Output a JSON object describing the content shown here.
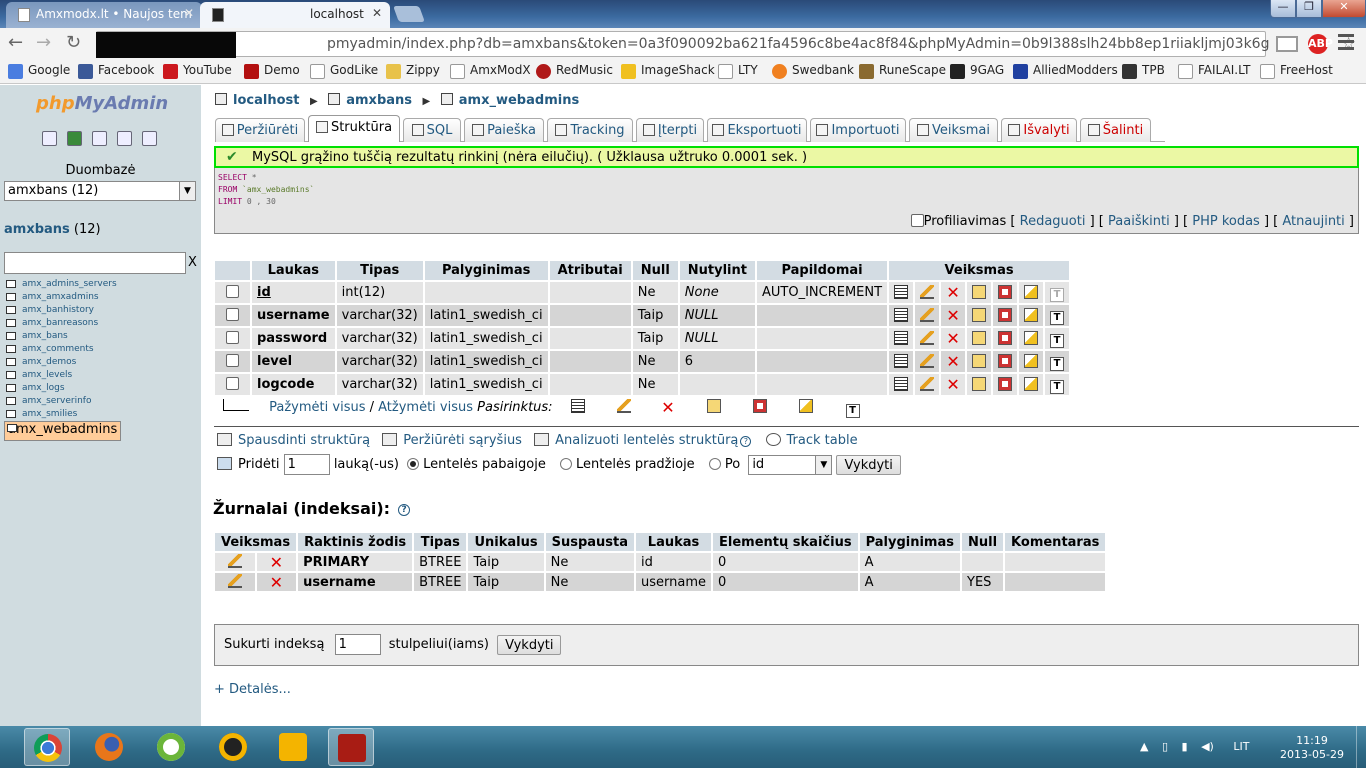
{
  "browser": {
    "tabs": [
      {
        "title": "Amxmodx.lt • Naujos tem"
      },
      {
        "title": "localhost"
      }
    ],
    "url": "pmyadmin/index.php?db=amxbans&token=0a3f090092ba621fa4596c8be4ac8f84&phpMyAdmin=0b9l388slh24bb8ep1riiakljmj03k6g",
    "bookmarks": [
      "Google",
      "Facebook",
      "YouTube",
      "Demo",
      "GodLike",
      "Zippy",
      "AmxModX",
      "RedMusic",
      "ImageShack",
      "LTY",
      "Swedbank",
      "RuneScape",
      "9GAG",
      "AlliedModders",
      "TPB",
      "FAILAI.LT",
      "FreeHost"
    ]
  },
  "sidebar": {
    "logo_a": "php",
    "logo_b": "MyAdmin",
    "db_label": "Duombazė",
    "db_select": "amxbans (12)",
    "db_name": "amxbans",
    "db_count": " (12)",
    "filter_clear": "X",
    "tables": [
      "amx_admins_servers",
      "amx_amxadmins",
      "amx_banhistory",
      "amx_banreasons",
      "amx_bans",
      "amx_comments",
      "amx_demos",
      "amx_levels",
      "amx_logs",
      "amx_serverinfo",
      "amx_smilies",
      "amx_webadmins"
    ]
  },
  "breadcrumb": {
    "server": "localhost",
    "db": "amxbans",
    "table": "amx_webadmins"
  },
  "tabs": [
    "Peržiūrėti",
    "Struktūra",
    "SQL",
    "Paieška",
    "Tracking",
    "Įterpti",
    "Eksportuoti",
    "Importuoti",
    "Veiksmai",
    "Išvalyti",
    "Šalinti"
  ],
  "message": "MySQL grąžino tuščią rezultatų rinkinį (nėra eilučių). ( Užklausa užtruko 0.0001 sek. )",
  "sql": {
    "l1_kw": "SELECT",
    "l1_rest": " *",
    "l2_kw": "FROM",
    "l2_tbl": " `amx_webadmins`",
    "l3_kw": "LIMIT",
    "l3_rest": " 0 , 30"
  },
  "sql_actions": {
    "profiling": "Profiliavimas",
    "edit": "Redaguoti",
    "explain": "Paaiškinti",
    "php": "PHP kodas",
    "refresh": "Atnaujinti"
  },
  "structure": {
    "headers": [
      "Laukas",
      "Tipas",
      "Palyginimas",
      "Atributai",
      "Null",
      "Nutylint",
      "Papildomai",
      "Veiksmas"
    ],
    "rows": [
      {
        "field": "id",
        "type": "int(12)",
        "collation": "",
        "attr": "",
        "null": "Ne",
        "default": "None",
        "extra": "AUTO_INCREMENT"
      },
      {
        "field": "username",
        "type": "varchar(32)",
        "collation": "latin1_swedish_ci",
        "attr": "",
        "null": "Taip",
        "default": "NULL",
        "extra": ""
      },
      {
        "field": "password",
        "type": "varchar(32)",
        "collation": "latin1_swedish_ci",
        "attr": "",
        "null": "Taip",
        "default": "NULL",
        "extra": ""
      },
      {
        "field": "level",
        "type": "varchar(32)",
        "collation": "latin1_swedish_ci",
        "attr": "",
        "null": "Ne",
        "default": "6",
        "extra": ""
      },
      {
        "field": "logcode",
        "type": "varchar(32)",
        "collation": "latin1_swedish_ci",
        "attr": "",
        "null": "Ne",
        "default": "",
        "extra": ""
      }
    ],
    "check_all": "Pažymėti visus",
    "uncheck_all": "Atžymėti visus",
    "with_selected": "Pasirinktus:"
  },
  "links": {
    "print": "Spausdinti struktūrą",
    "relations": "Peržiūrėti sąryšius",
    "analyze": "Analizuoti lentelės struktūrą",
    "track": "Track table"
  },
  "add_field": {
    "label": "Pridėti",
    "count": "1",
    "unit": "lauką(-us)",
    "at_end": "Lentelės pabaigoje",
    "at_start": "Lentelės pradžioje",
    "after": "Po",
    "after_field": "id",
    "go": "Vykdyti"
  },
  "indexes": {
    "title": "Žurnalai (indeksai):",
    "headers": [
      "Veiksmas",
      "Raktinis žodis",
      "Tipas",
      "Unikalus",
      "Suspausta",
      "Laukas",
      "Elementų skaičius",
      "Palyginimas",
      "Null",
      "Komentaras"
    ],
    "rows": [
      {
        "key": "PRIMARY",
        "type": "BTREE",
        "unique": "Taip",
        "packed": "Ne",
        "field": "id",
        "cardinality": "0",
        "collation": "A",
        "null": "",
        "comment": ""
      },
      {
        "key": "username",
        "type": "BTREE",
        "unique": "Taip",
        "packed": "Ne",
        "field": "username",
        "cardinality": "0",
        "collation": "A",
        "null": "YES",
        "comment": ""
      }
    ]
  },
  "create_index": {
    "label": "Sukurti indeksą",
    "count": "1",
    "suffix": "stulpeliui(iams)",
    "go": "Vykdyti"
  },
  "details": "+ Detalės...",
  "taskbar": {
    "lang": "LIT",
    "time": "11:19",
    "date": "2013-05-29"
  }
}
